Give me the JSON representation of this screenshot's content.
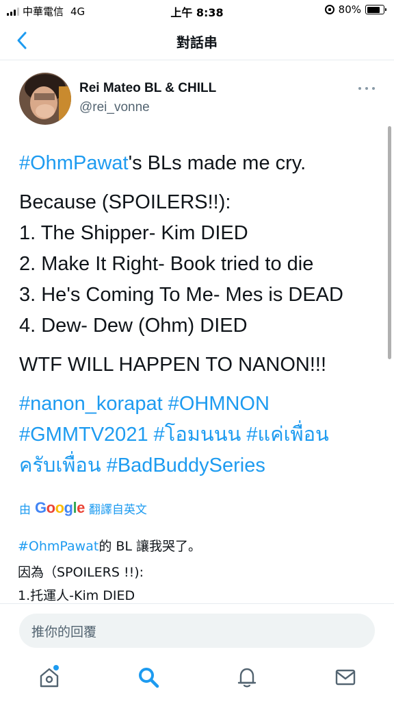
{
  "status_bar": {
    "carrier": "中華電信",
    "network": "4G",
    "time": "上午 8:38",
    "battery": "80%",
    "battery_level": 0.8
  },
  "header": {
    "title": "對話串"
  },
  "tweet": {
    "author_name": "Rei Mateo BL & CHILL",
    "author_handle": "@rei_vonne",
    "line1_hashtag": "#OhmPawat",
    "line1_text": "'s BLs made me cry.",
    "line2": "Because (SPOILERS!!):",
    "line3": "1. The Shipper- Kim DIED",
    "line4": "2. Make It Right- Book tried to die",
    "line5": "3. He's Coming To Me- Mes is DEAD",
    "line6": "4. Dew- Dew (Ohm) DIED",
    "line7": "WTF WILL HAPPEN TO NANON!!!",
    "hashtags_line1": "#nanon_korapat #OHMNON",
    "hashtags_line2": "#GMMTV2021 #โอมนนน #แค่เพื่อน",
    "hashtags_line3": "ครับเพื่อน #BadBuddySeries"
  },
  "translation": {
    "prefix": "由",
    "provider_letters": [
      "G",
      "o",
      "o",
      "g",
      "l",
      "e"
    ],
    "suffix": "翻譯自英文",
    "line1_hashtag": "#OhmPawat",
    "line1_text": "的 BL 讓我哭了。",
    "line2": "因為（SPOILERS !!):",
    "line3": "1.托運人-Kim DIED"
  },
  "reply": {
    "placeholder": "推你的回覆"
  },
  "tab_bar": {
    "icons": [
      "home-icon",
      "search-icon",
      "bell-icon",
      "mail-icon"
    ],
    "accent": "#1d9bf0"
  }
}
